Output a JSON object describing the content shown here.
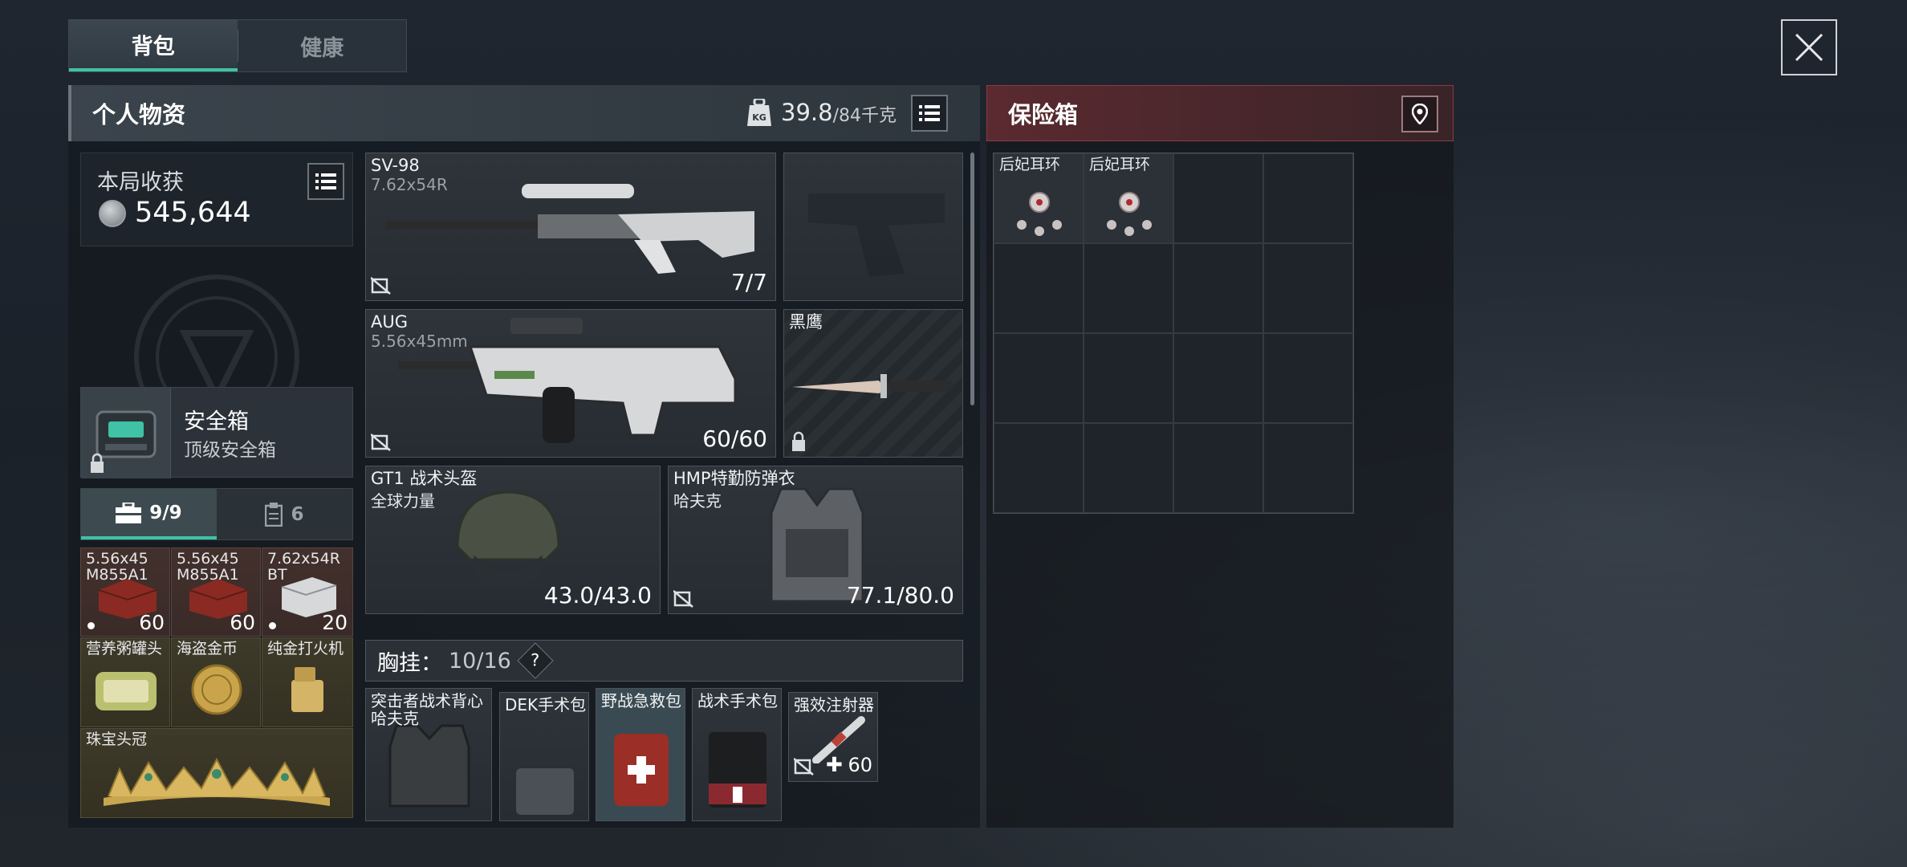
{
  "tabs": [
    {
      "label": "背包",
      "active": true
    },
    {
      "label": "健康",
      "active": false
    }
  ],
  "personal": {
    "title": "个人物资",
    "weight_current": "39.8",
    "weight_max": "/84千克",
    "weight_icon_text": "KG"
  },
  "earnings": {
    "title": "本局收获",
    "value": "545,644"
  },
  "safebox": {
    "title": "安全箱",
    "subtitle": "顶级安全箱"
  },
  "subtabs": [
    {
      "label": "9/9",
      "icon": "toolbox-icon",
      "active": true
    },
    {
      "label": "6",
      "icon": "clipboard-icon",
      "active": false
    }
  ],
  "pocket_items": [
    {
      "label": "5.56x45\nM855A1",
      "count": "60"
    },
    {
      "label": "5.56x45\nM855A1",
      "count": "60"
    },
    {
      "label": "7.62x54R\nBT",
      "count": "20"
    },
    {
      "label": "营养粥罐头"
    },
    {
      "label": "海盗金币"
    },
    {
      "label": "纯金打火机"
    },
    {
      "label": "珠宝头冠"
    }
  ],
  "weapons": {
    "primary": {
      "name": "SV-98",
      "caliber": "7.62x54R",
      "ammo": "7/7"
    },
    "secondary": {
      "name": "AUG",
      "caliber": "5.56x45mm",
      "ammo": "60/60"
    },
    "melee": {
      "name": "黑鹰"
    }
  },
  "helmet": {
    "name": "GT1 战术头盔",
    "brand": "全球力量",
    "durability": "43.0/43.0"
  },
  "armor": {
    "name": "HMP特勤防弹衣",
    "brand": "哈夫克",
    "durability": "77.1/80.0"
  },
  "rig": {
    "label": "胸挂：",
    "count": "10/16",
    "help": "?"
  },
  "rig_items": [
    {
      "label": "突击者战术背心\n哈夫克"
    },
    {
      "label": "DEK手术包"
    },
    {
      "label": "野战急救包"
    },
    {
      "label": "战术手术包"
    },
    {
      "label": "强效注射器",
      "count": "60"
    }
  ],
  "secure_box": {
    "title": "保险箱",
    "items": [
      {
        "label": "后妃耳环"
      },
      {
        "label": "后妃耳环"
      }
    ]
  },
  "colors": {
    "accent": "#3fc2a6",
    "secure_header": "#5a2a30"
  }
}
